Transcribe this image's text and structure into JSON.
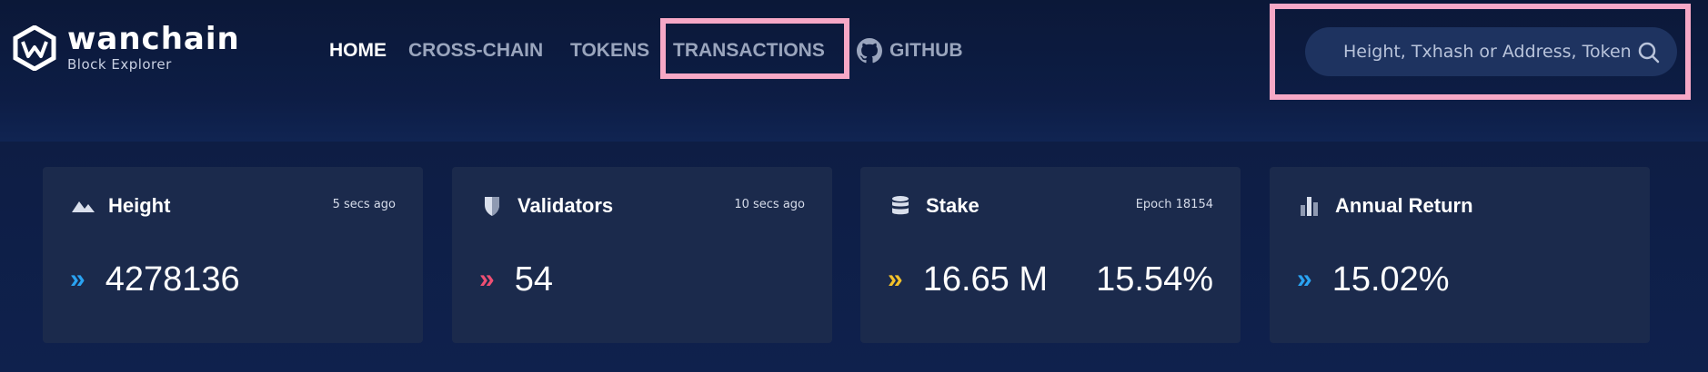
{
  "brand": {
    "name": "wanchain",
    "subtitle": "Block Explorer"
  },
  "nav": {
    "items": [
      {
        "label": "HOME",
        "active": true
      },
      {
        "label": "CROSS-CHAIN",
        "active": false
      },
      {
        "label": "TOKENS",
        "active": false
      },
      {
        "label": "TRANSACTIONS",
        "active": false
      },
      {
        "label": "GITHUB",
        "active": false,
        "icon": "github-icon"
      }
    ]
  },
  "search": {
    "placeholder": "Height, Txhash or Address, Token Address",
    "icon": "search-icon"
  },
  "stats": [
    {
      "title": "Height",
      "meta": "5 secs ago",
      "value": "4278136",
      "icon": "mountain-icon",
      "chevron_color": "#2aa3f2"
    },
    {
      "title": "Validators",
      "meta": "10 secs ago",
      "value": "54",
      "icon": "shield-icon",
      "chevron_color": "#ef4f73"
    },
    {
      "title": "Stake",
      "meta": "Epoch 18154",
      "value": "16.65 M",
      "value2": "15.54%",
      "icon": "database-icon",
      "chevron_color": "#f2c12a"
    },
    {
      "title": "Annual Return",
      "meta": "",
      "value": "15.02%",
      "icon": "bar-chart-icon",
      "chevron_color": "#2aa3f2"
    }
  ],
  "chevron_glyph": "»",
  "colors": {
    "highlight": "#f7a8c6",
    "header_bg": "#0b1838",
    "card_bg": "#1b2a4c"
  }
}
